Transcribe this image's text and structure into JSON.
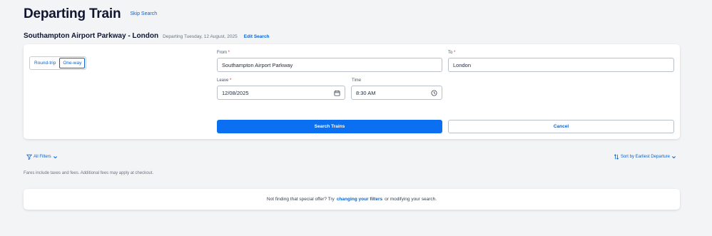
{
  "header": {
    "title": "Departing Train",
    "skip_label": "Skip Search"
  },
  "route": {
    "name": "Southampton Airport Parkway - London",
    "date": "Departing Tuesday, 12 August, 2025",
    "edit_label": "Edit Search"
  },
  "form": {
    "trip_options": [
      "Round-trip",
      "One-way"
    ],
    "selected_trip": "One-way",
    "from_label": "From",
    "from_value": "Southampton Airport Parkway",
    "to_label": "To",
    "to_value": "London",
    "leave_label": "Leave",
    "leave_value": "12/08/2025",
    "time_label": "Time",
    "time_value": "8:30 AM",
    "required_mark": "*",
    "search_label": "Search Trains",
    "cancel_label": "Cancel"
  },
  "filters": {
    "all_filters_label": "All Filters",
    "sort_label": "Sort by Earliest Departure"
  },
  "fares_note": "Fares include taxes and fees. Additional fees may apply at checkout.",
  "notice": {
    "before": "Not finding that special offer? Try",
    "link": "changing your filters",
    "after": "or modifying your search."
  },
  "colors": {
    "accent": "#0a6ff0",
    "link": "#0b63ce",
    "required": "#d62d2d"
  },
  "icons": {
    "calendar": "calendar-icon",
    "clock": "clock-icon",
    "filter": "filter-icon",
    "sort": "sort-icon"
  }
}
